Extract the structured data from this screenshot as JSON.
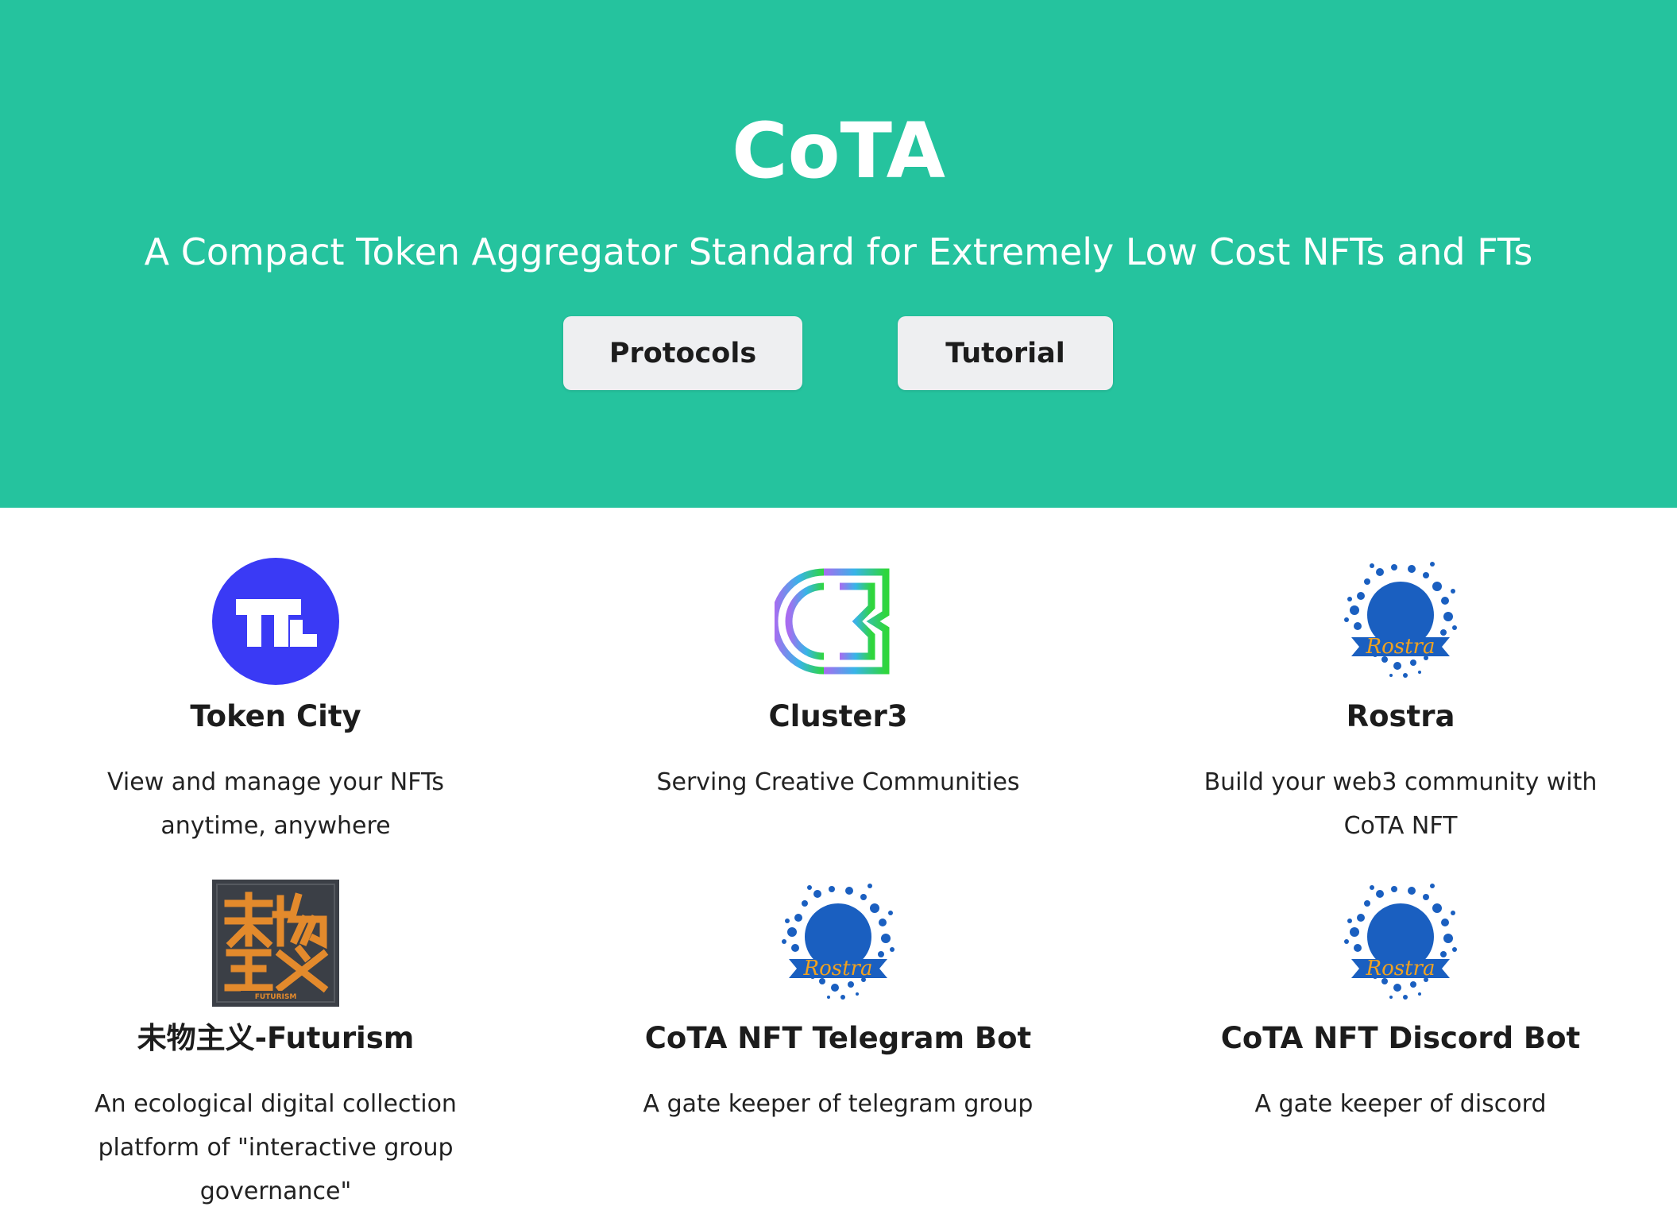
{
  "hero": {
    "title": "CoTA",
    "subtitle": "A Compact Token Aggregator Standard for Extremely Low Cost NFTs and FTs",
    "background_color": "#25c39e",
    "buttons": {
      "protocols": "Protocols",
      "tutorial": "Tutorial"
    }
  },
  "projects": [
    {
      "name": "Token City",
      "description": "View and manage your NFTs anytime, anywhere",
      "icon": "token-city-logo"
    },
    {
      "name": "Cluster3",
      "description": "Serving Creative Communities",
      "icon": "cluster3-logo"
    },
    {
      "name": "Rostra",
      "description": "Build your web3 community with CoTA NFT",
      "icon": "rostra-logo",
      "logo_text": "Rostra"
    },
    {
      "name": "未物主义-Futurism",
      "description": "An ecological digital collection platform of \"interactive group governance\"",
      "icon": "futurism-logo",
      "logo_text": "FUTURISM"
    },
    {
      "name": "CoTA NFT Telegram Bot",
      "description": "A gate keeper of telegram group",
      "icon": "rostra-logo",
      "logo_text": "Rostra"
    },
    {
      "name": "CoTA NFT Discord Bot",
      "description": "A gate keeper of discord",
      "icon": "rostra-logo",
      "logo_text": "Rostra"
    }
  ]
}
